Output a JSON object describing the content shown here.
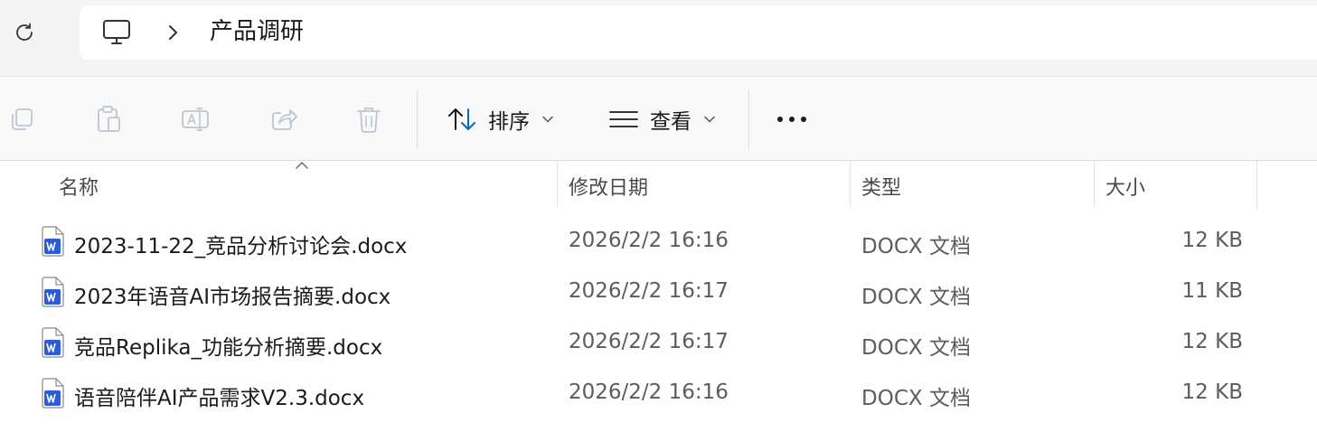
{
  "address": {
    "breadcrumb": [
      "此电脑",
      "产品调研"
    ],
    "current_folder": "产品调研"
  },
  "command_bar": {
    "sort_label": "排序",
    "view_label": "查看"
  },
  "columns": {
    "name": "名称",
    "date": "修改日期",
    "type": "类型",
    "size": "大小"
  },
  "files": [
    {
      "name": "2023-11-22_竞品分析讨论会.docx",
      "date": "2026/2/2 16:16",
      "type": "DOCX 文档",
      "size": "12 KB"
    },
    {
      "name": "2023年语音AI市场报告摘要.docx",
      "date": "2026/2/2 16:17",
      "type": "DOCX 文档",
      "size": "11 KB"
    },
    {
      "name": "竞品Replika_功能分析摘要.docx",
      "date": "2026/2/2 16:17",
      "type": "DOCX 文档",
      "size": "12 KB"
    },
    {
      "name": "语音陪伴AI产品需求V2.3.docx",
      "date": "2026/2/2 16:16",
      "type": "DOCX 文档",
      "size": "12 KB"
    }
  ],
  "colors": {
    "word_icon_blue": "#2b5cd6",
    "accent": "#0067c0"
  },
  "icons": [
    "refresh-icon",
    "computer-icon",
    "chevron-right-icon",
    "copy-icon",
    "paste-icon",
    "rename-icon",
    "share-icon",
    "delete-icon",
    "sort-icon",
    "view-icon",
    "more-icon",
    "word-doc-icon"
  ]
}
